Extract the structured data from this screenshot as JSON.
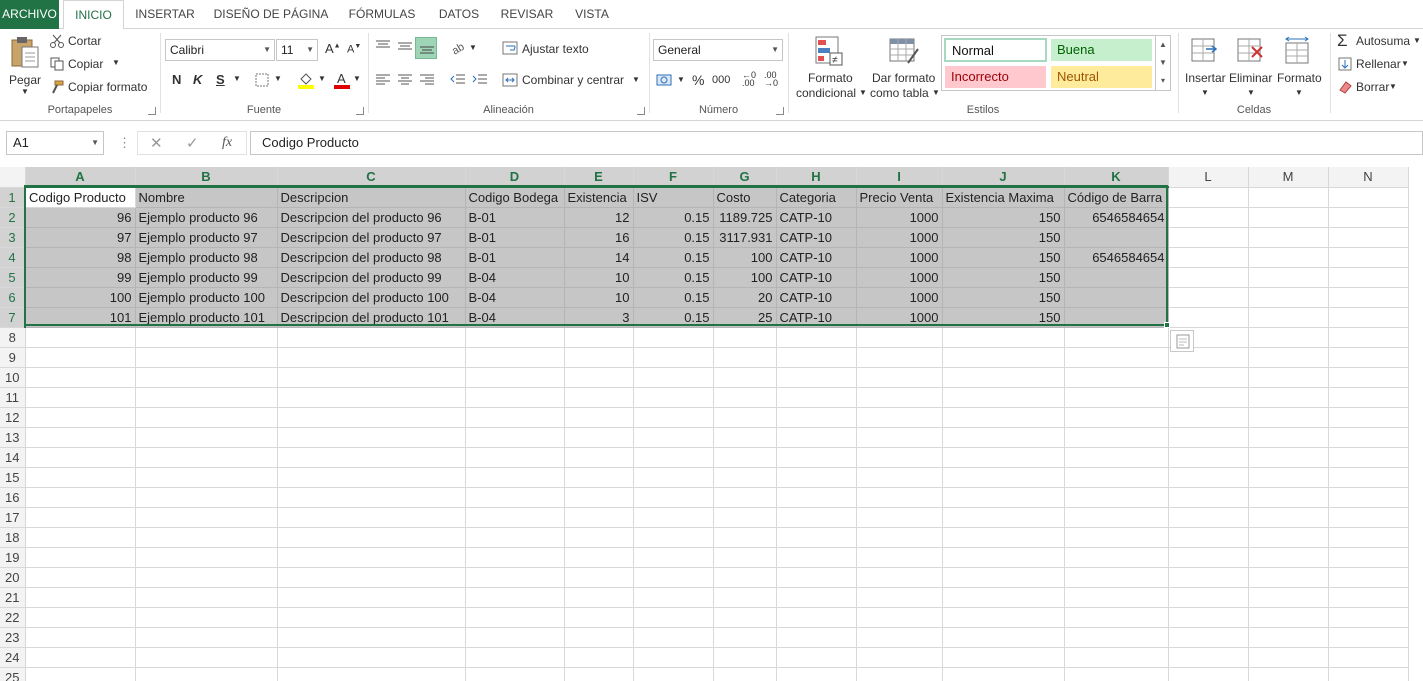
{
  "tabs": [
    {
      "label": "ARCHIVO"
    },
    {
      "label": "INICIO"
    },
    {
      "label": "INSERTAR"
    },
    {
      "label": "DISEÑO DE PÁGINA"
    },
    {
      "label": "FÓRMULAS"
    },
    {
      "label": "DATOS"
    },
    {
      "label": "REVISAR"
    },
    {
      "label": "VISTA"
    }
  ],
  "ribbon": {
    "clipboard": {
      "paste": "Pegar",
      "cut": "Cortar",
      "copy": "Copiar",
      "format_painter": "Copiar formato",
      "label": "Portapapeles"
    },
    "font": {
      "name": "Calibri",
      "size": "11",
      "bold": "N",
      "italic": "K",
      "underline": "S",
      "label": "Fuente"
    },
    "alignment": {
      "wrap": "Ajustar texto",
      "merge": "Combinar y centrar",
      "label": "Alineación"
    },
    "number": {
      "format": "General",
      "percent": "%",
      "thousands": "000",
      "label": "Número"
    },
    "styles": {
      "cond_format": [
        "Formato",
        "condicional"
      ],
      "as_table": [
        "Dar formato",
        "como tabla"
      ],
      "normal": "Normal",
      "good": "Buena",
      "bad": "Incorrecto",
      "neutral": "Neutral",
      "label": "Estilos"
    },
    "cells": {
      "insert": "Insertar",
      "delete": "Eliminar",
      "format": "Formato",
      "label": "Celdas"
    },
    "editing": {
      "autosum": "Autosuma",
      "fill": "Rellenar",
      "clear": "Borrar"
    }
  },
  "formula_bar": {
    "name_box": "A1",
    "fx": "fx",
    "content": "Codigo Producto"
  },
  "colors": {
    "accent": "#217346",
    "selection": "#c6c6c6",
    "good_bg": "#c6efce",
    "good_fg": "#006100",
    "bad_bg": "#ffc7ce",
    "bad_fg": "#9c0006",
    "neutral_bg": "#ffeb9c",
    "neutral_fg": "#9c5700"
  },
  "columns": [
    "A",
    "B",
    "C",
    "D",
    "E",
    "F",
    "G",
    "H",
    "I",
    "J",
    "K",
    "L",
    "M",
    "N"
  ],
  "rows": [
    [
      "Codigo Producto",
      "Nombre",
      "Descripcion",
      "Codigo Bodega",
      "Existencia",
      "ISV",
      "Costo",
      "Categoria",
      "Precio Venta",
      "Existencia Maxima",
      "Código de Barra"
    ],
    [
      "96",
      "Ejemplo producto 96",
      "Descripcion del producto 96",
      "B-01",
      "12",
      "0.15",
      "1189.725",
      "CATP-10",
      "1000",
      "150",
      "6546584654"
    ],
    [
      "97",
      "Ejemplo producto 97",
      "Descripcion del producto 97",
      "B-01",
      "16",
      "0.15",
      "3117.931",
      "CATP-10",
      "1000",
      "150",
      ""
    ],
    [
      "98",
      "Ejemplo producto 98",
      "Descripcion del producto 98",
      "B-01",
      "14",
      "0.15",
      "100",
      "CATP-10",
      "1000",
      "150",
      "6546584654"
    ],
    [
      "99",
      "Ejemplo producto 99",
      "Descripcion del producto 99",
      "B-04",
      "10",
      "0.15",
      "100",
      "CATP-10",
      "1000",
      "150",
      ""
    ],
    [
      "100",
      "Ejemplo producto 100",
      "Descripcion del producto 100",
      "B-04",
      "10",
      "0.15",
      "20",
      "CATP-10",
      "1000",
      "150",
      ""
    ],
    [
      "101",
      "Ejemplo producto 101",
      "Descripcion del producto 101",
      "B-04",
      "3",
      "0.15",
      "25",
      "CATP-10",
      "1000",
      "150",
      ""
    ]
  ],
  "row_numbers": [
    "1",
    "2",
    "3",
    "4",
    "5",
    "6",
    "7",
    "8",
    "9",
    "10",
    "11",
    "12",
    "13",
    "14",
    "15",
    "16",
    "17",
    "18",
    "19",
    "20",
    "21",
    "22",
    "23",
    "24",
    "25"
  ]
}
